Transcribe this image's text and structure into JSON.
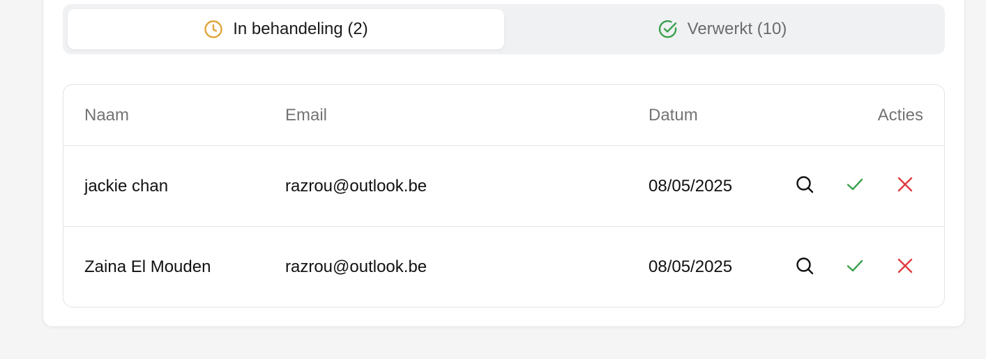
{
  "tabs": {
    "pending_label": "In behandeling (2)",
    "done_label": "Verwerkt (10)",
    "pending_icon": "clock-icon",
    "done_icon": "check-circle-icon",
    "pending_icon_color": "#e0a53a",
    "done_icon_color": "#3aa14d"
  },
  "table": {
    "columns": [
      "Naam",
      "Email",
      "Datum",
      "Acties"
    ],
    "rows": [
      {
        "name": "jackie chan",
        "email": "razrou@outlook.be",
        "date": "08/05/2025"
      },
      {
        "name": "Zaina El Mouden",
        "email": "razrou@outlook.be",
        "date": "08/05/2025"
      }
    ],
    "action_icons": [
      "search-icon",
      "check-icon",
      "close-icon"
    ],
    "accept_color": "#3aa14d",
    "reject_color": "#e0393e"
  }
}
